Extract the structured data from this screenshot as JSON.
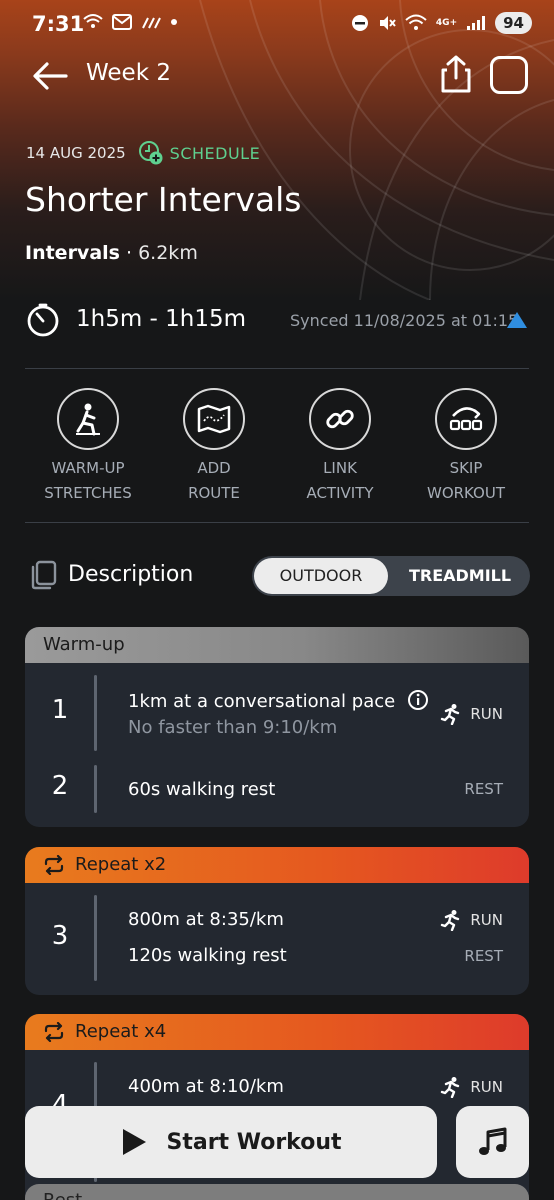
{
  "status": {
    "time": "7:31",
    "battery": "94",
    "net_label": "4G+"
  },
  "header": {
    "title": "Week 2"
  },
  "workout": {
    "date": "14 AUG 2025",
    "schedule_label": "SCHEDULE",
    "title": "Shorter Intervals",
    "type": "Intervals",
    "separator": " · ",
    "distance": "6.2km",
    "duration": "1h5m - 1h15m",
    "synced": "Synced 11/08/2025 at 01:15"
  },
  "actions": [
    {
      "label": "WARM-UP\nSTRETCHES",
      "icon": "stretch-icon"
    },
    {
      "label": "ADD\nROUTE",
      "icon": "map-icon"
    },
    {
      "label": "LINK\nACTIVITY",
      "icon": "link-icon"
    },
    {
      "label": "SKIP\nWORKOUT",
      "icon": "skip-icon"
    }
  ],
  "description": {
    "label": "Description",
    "toggle_outdoor": "OUTDOOR",
    "toggle_treadmill": "TREADMILL",
    "selected": "OUTDOOR"
  },
  "sections": {
    "warmup": {
      "title": "Warm-up",
      "steps": [
        {
          "num": "1",
          "text": "1km at a conversational pace",
          "sub": "No faster than 9:10/km",
          "type": "RUN"
        },
        {
          "num": "2",
          "text": "60s walking rest",
          "type": "REST"
        }
      ]
    },
    "repeat1": {
      "title": "Repeat x2",
      "num": "3",
      "steps": [
        {
          "text": "800m at 8:35/km",
          "type": "RUN"
        },
        {
          "text": "120s walking rest",
          "type": "REST"
        }
      ]
    },
    "repeat2": {
      "title": "Repeat x4",
      "num": "4",
      "steps": [
        {
          "text": "400m at 8:10/km",
          "type": "RUN"
        }
      ]
    },
    "rest_peek": {
      "title": "Rest"
    }
  },
  "footer": {
    "start_label": "Start Workout"
  },
  "colors": {
    "accent_green": "#5fd08f",
    "repeat_orange": "#e5581f",
    "sync_blue": "#2f8ee0"
  }
}
